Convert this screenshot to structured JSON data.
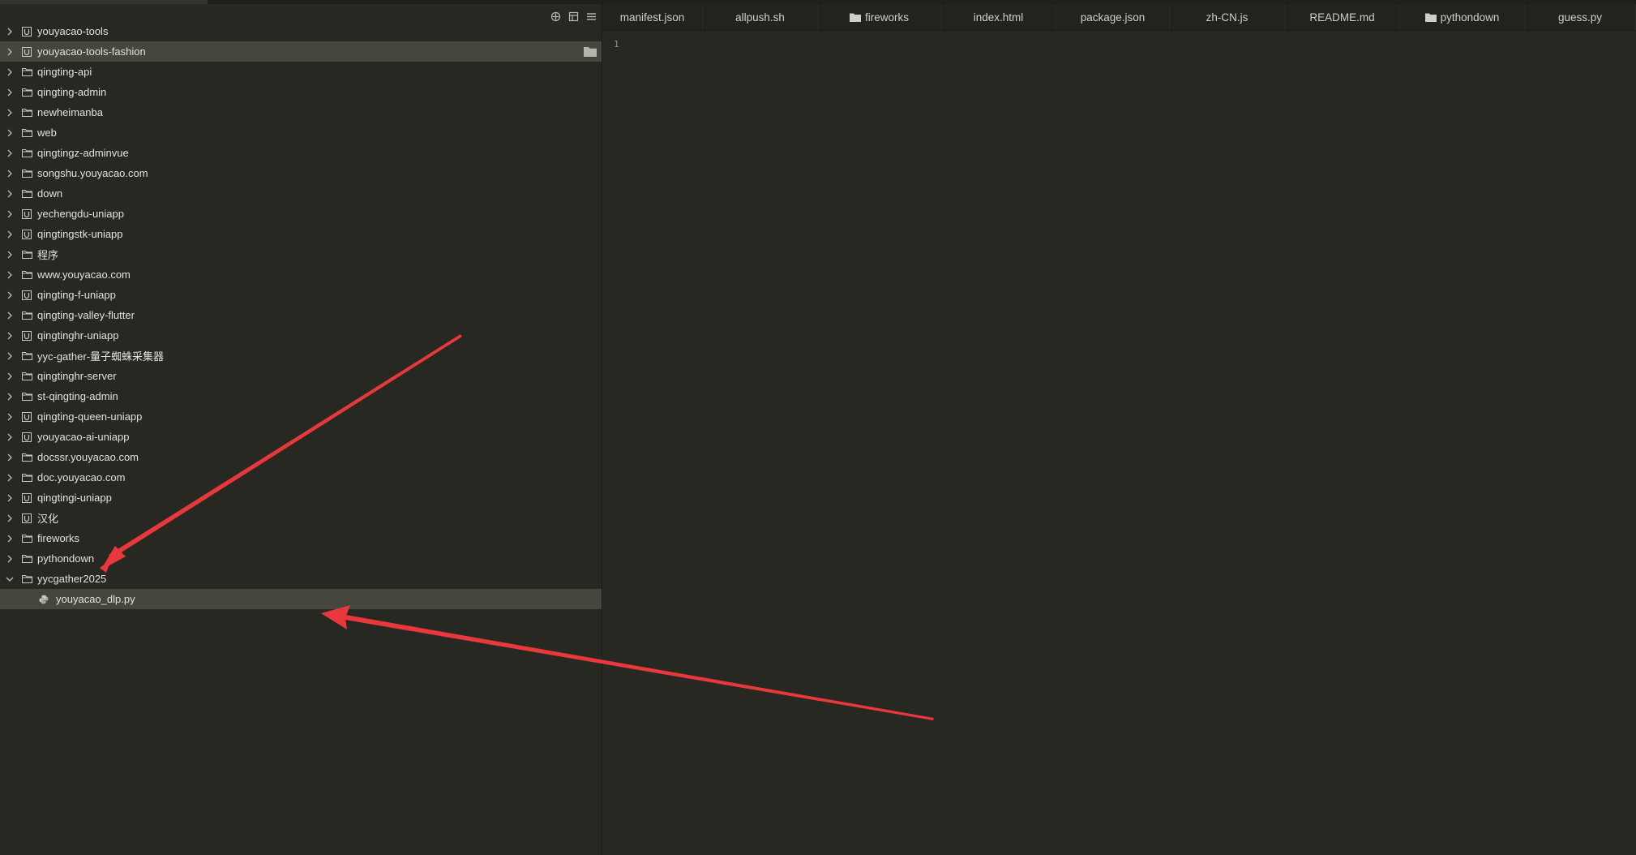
{
  "sidebar": {
    "toolbar": {
      "icons": [
        "add-target-icon",
        "collapse-icon",
        "menu-icon"
      ],
      "glyphs": [
        "⊕",
        "⧉",
        "☰"
      ]
    },
    "items": [
      {
        "label": "youyacao-tools",
        "icon": "project-icon",
        "expanded": false
      },
      {
        "label": "youyacao-tools-fashion",
        "icon": "project-icon",
        "expanded": false,
        "highlighted": true
      },
      {
        "label": "qingting-api",
        "icon": "folder-icon",
        "expanded": false
      },
      {
        "label": "qingting-admin",
        "icon": "folder-icon",
        "expanded": false
      },
      {
        "label": "newheimanba",
        "icon": "folder-icon",
        "expanded": false
      },
      {
        "label": "web",
        "icon": "folder-icon",
        "expanded": false
      },
      {
        "label": "qingtingz-adminvue",
        "icon": "folder-icon",
        "expanded": false
      },
      {
        "label": "songshu.youyacao.com",
        "icon": "folder-icon",
        "expanded": false
      },
      {
        "label": "down",
        "icon": "folder-icon",
        "expanded": false
      },
      {
        "label": "yechengdu-uniapp",
        "icon": "project-icon",
        "expanded": false
      },
      {
        "label": "qingtingstk-uniapp",
        "icon": "project-icon",
        "expanded": false
      },
      {
        "label": "程序",
        "icon": "folder-icon",
        "expanded": false
      },
      {
        "label": "www.youyacao.com",
        "icon": "folder-icon",
        "expanded": false
      },
      {
        "label": "qingting-f-uniapp",
        "icon": "project-icon",
        "expanded": false
      },
      {
        "label": "qingting-valley-flutter",
        "icon": "folder-icon",
        "expanded": false
      },
      {
        "label": "qingtinghr-uniapp",
        "icon": "project-icon",
        "expanded": false
      },
      {
        "label": "yyc-gather-量子蜘蛛采集器",
        "icon": "folder-icon",
        "expanded": false
      },
      {
        "label": "qingtinghr-server",
        "icon": "folder-icon",
        "expanded": false
      },
      {
        "label": "st-qingting-admin",
        "icon": "folder-icon",
        "expanded": false
      },
      {
        "label": "qingting-queen-uniapp",
        "icon": "project-icon",
        "expanded": false
      },
      {
        "label": "youyacao-ai-uniapp",
        "icon": "project-icon",
        "expanded": false
      },
      {
        "label": "docssr.youyacao.com",
        "icon": "folder-icon",
        "expanded": false
      },
      {
        "label": "doc.youyacao.com",
        "icon": "folder-icon",
        "expanded": false
      },
      {
        "label": "qingtingi-uniapp",
        "icon": "project-icon",
        "expanded": false
      },
      {
        "label": "汉化",
        "icon": "project-icon",
        "expanded": false
      },
      {
        "label": "fireworks",
        "icon": "folder-icon",
        "expanded": false
      },
      {
        "label": "pythondown",
        "icon": "folder-icon",
        "expanded": false
      },
      {
        "label": "yycgather2025",
        "icon": "folder-icon",
        "expanded": true
      }
    ],
    "child": {
      "label": "youyacao_dlp.py",
      "icon": "python-file-icon",
      "selected": true
    }
  },
  "tabs": [
    {
      "label": "manifest.json",
      "icon": ""
    },
    {
      "label": "allpush.sh",
      "icon": ""
    },
    {
      "label": "fireworks",
      "icon": "folder-icon"
    },
    {
      "label": "index.html",
      "icon": ""
    },
    {
      "label": "package.json",
      "icon": ""
    },
    {
      "label": "zh-CN.js",
      "icon": ""
    },
    {
      "label": "README.md",
      "icon": ""
    },
    {
      "label": "pythondown",
      "icon": "folder-icon"
    },
    {
      "label": "guess.py",
      "icon": ""
    }
  ],
  "editor": {
    "line_numbers": [
      "1"
    ]
  },
  "colors": {
    "background": "#272822",
    "highlight_row": "#45463d",
    "annotation_arrow": "#e8383b"
  }
}
